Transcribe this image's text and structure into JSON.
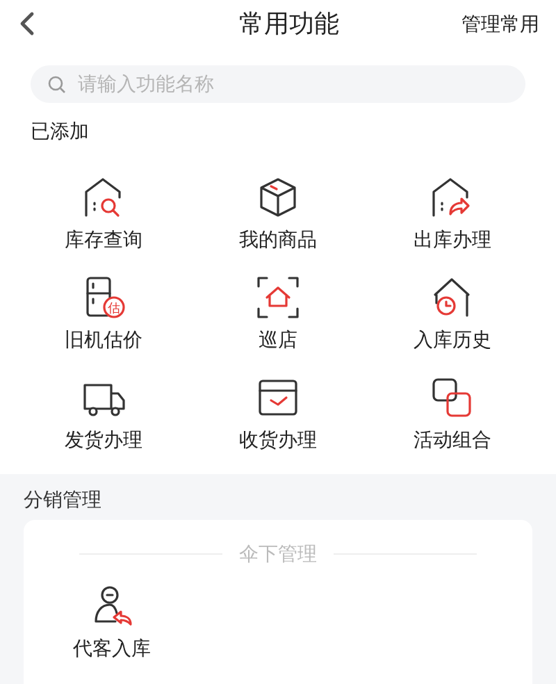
{
  "header": {
    "title": "常用功能",
    "action": "管理常用"
  },
  "search": {
    "placeholder": "请输入功能名称"
  },
  "added": {
    "title": "已添加",
    "items": [
      {
        "label": "库存查询",
        "kind": "house-search"
      },
      {
        "label": "我的商品",
        "kind": "box"
      },
      {
        "label": "出库办理",
        "kind": "house-out"
      },
      {
        "label": "旧机估价",
        "kind": "fridge",
        "icon_text": "估"
      },
      {
        "label": "巡店",
        "kind": "scan-house"
      },
      {
        "label": "入库历史",
        "kind": "house-clock"
      },
      {
        "label": "发货办理",
        "kind": "truck"
      },
      {
        "label": "收货办理",
        "kind": "tray-check"
      },
      {
        "label": "活动组合",
        "kind": "link-squares"
      }
    ]
  },
  "distribution": {
    "title": "分销管理",
    "group": "伞下管理",
    "items": [
      {
        "label": "代客入库",
        "kind": "person-return"
      }
    ]
  }
}
